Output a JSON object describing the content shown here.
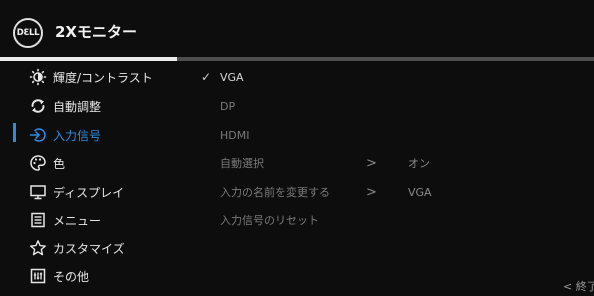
{
  "header": {
    "logo_text": "DƐLL",
    "title": "2Xモニター"
  },
  "menu": [
    {
      "label": "輝度/コントラスト",
      "icon": "brightness-icon"
    },
    {
      "label": "自動調整",
      "icon": "auto-adjust-icon"
    },
    {
      "label": "入力信号",
      "icon": "input-source-icon",
      "active": true
    },
    {
      "label": "色",
      "icon": "color-palette-icon"
    },
    {
      "label": "ディスプレイ",
      "icon": "display-icon"
    },
    {
      "label": "メニュー",
      "icon": "menu-icon"
    },
    {
      "label": "カスタマイズ",
      "icon": "star-icon"
    },
    {
      "label": "その他",
      "icon": "others-icon"
    }
  ],
  "options": [
    {
      "label": "VGA",
      "selected": true,
      "check": "✓"
    },
    {
      "label": "DP"
    },
    {
      "label": "HDMI"
    },
    {
      "label": "自動選択",
      "arrow": ">",
      "value": "オン"
    },
    {
      "label": "入力の名前を変更する",
      "arrow": ">",
      "value": "VGA"
    },
    {
      "label": "入力信号のリセット"
    }
  ],
  "footer": {
    "exit_label": "< 終了"
  },
  "colors": {
    "accent": "#2e8be0",
    "background": "#0d0d0d"
  }
}
